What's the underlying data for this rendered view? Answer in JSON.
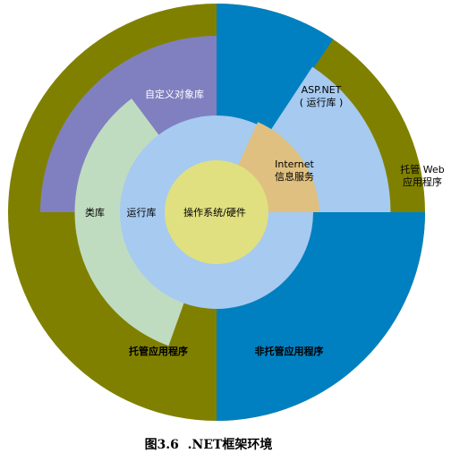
{
  "diagram": {
    "labels": {
      "os_hardware": "操作系统/硬件",
      "runtime": "运行库",
      "class_library": "类库",
      "custom_object_library": "自定义对象库",
      "aspnet_line1": "ASP.NET",
      "aspnet_line2": "( 运行库 )",
      "iis_line1": "Internet",
      "iis_line2": "信息服务",
      "managed_web_line1": "托管  Web",
      "managed_web_line2": "应用程序",
      "managed_apps": "托管应用程序",
      "unmanaged_apps": "非托管应用程序"
    },
    "caption": "图3.6  .NET框架环境"
  },
  "colors": {
    "olive_ring": "#808000",
    "unmanaged_blue": "#0080c0",
    "custom_lib_purple": "#8080c0",
    "class_lib_green": "#c0dcc0",
    "runtime_blue": "#a6caf0",
    "aspnet_light_blue": "#a6caf0",
    "iis_tan": "#dfc080",
    "core_yellow": "#e0e080"
  }
}
